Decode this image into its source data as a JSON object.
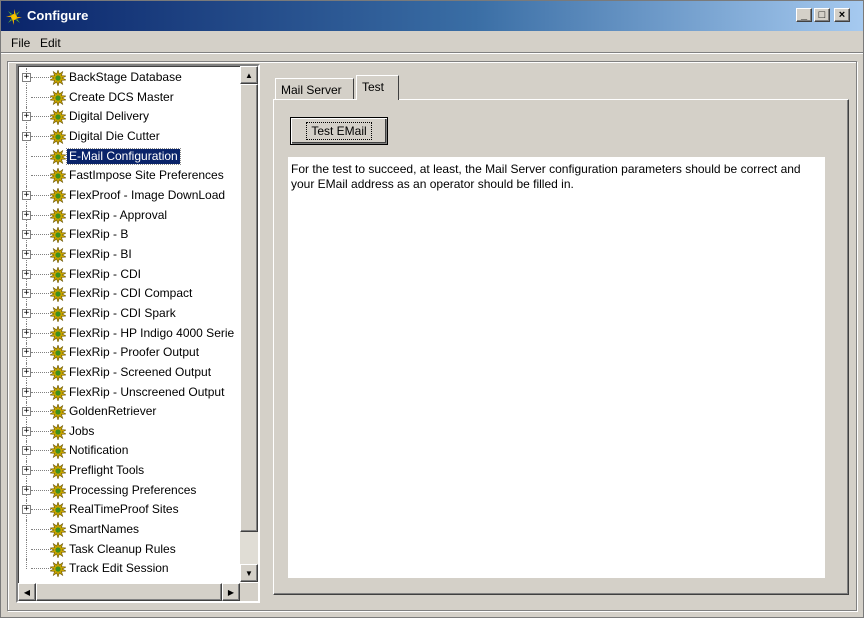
{
  "window": {
    "title": "Configure",
    "controls": {
      "minimize": "_",
      "maximize": "□",
      "close": "×"
    }
  },
  "menu": [
    "File",
    "Edit"
  ],
  "tree": {
    "items": [
      {
        "label": "BackStage Database",
        "expandable": true
      },
      {
        "label": "Create DCS Master",
        "expandable": false
      },
      {
        "label": "Digital Delivery",
        "expandable": true
      },
      {
        "label": "Digital Die Cutter",
        "expandable": true
      },
      {
        "label": "E-Mail Configuration",
        "expandable": false,
        "selected": true
      },
      {
        "label": "FastImpose Site Preferences",
        "expandable": false
      },
      {
        "label": "FlexProof - Image DownLoad",
        "expandable": true
      },
      {
        "label": "FlexRip - Approval",
        "expandable": true
      },
      {
        "label": "FlexRip - B",
        "expandable": true
      },
      {
        "label": "FlexRip - BI",
        "expandable": true
      },
      {
        "label": "FlexRip - CDI",
        "expandable": true
      },
      {
        "label": "FlexRip - CDI Compact",
        "expandable": true
      },
      {
        "label": "FlexRip - CDI Spark",
        "expandable": true
      },
      {
        "label": "FlexRip - HP Indigo 4000 Serie",
        "expandable": true
      },
      {
        "label": "FlexRip - Proofer Output",
        "expandable": true
      },
      {
        "label": "FlexRip - Screened Output",
        "expandable": true
      },
      {
        "label": "FlexRip - Unscreened Output",
        "expandable": true
      },
      {
        "label": "GoldenRetriever",
        "expandable": true
      },
      {
        "label": "Jobs",
        "expandable": true
      },
      {
        "label": "Notification",
        "expandable": true
      },
      {
        "label": "Preflight Tools",
        "expandable": true
      },
      {
        "label": "Processing Preferences",
        "expandable": true
      },
      {
        "label": "RealTimeProof Sites",
        "expandable": true
      },
      {
        "label": "SmartNames",
        "expandable": false
      },
      {
        "label": "Task Cleanup Rules",
        "expandable": false
      },
      {
        "label": "Track Edit Session",
        "expandable": false
      }
    ]
  },
  "tabs": [
    {
      "label": "Mail Server",
      "active": false
    },
    {
      "label": "Test",
      "active": true
    }
  ],
  "test_panel": {
    "button_label": "Test EMail",
    "message": "For the test to succeed, at least, the Mail Server configuration parameters should be correct and your EMail address as an operator should be filled in."
  },
  "colors": {
    "titlebar_start": "#0a246a",
    "titlebar_end": "#a6caf0",
    "selection": "#0a246a",
    "face": "#d4d0c8"
  }
}
